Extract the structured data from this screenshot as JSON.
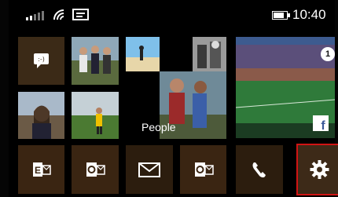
{
  "status_bar": {
    "time": "10:40",
    "icons": [
      "signal-icon",
      "wifi-icon",
      "message-icon",
      "battery-icon"
    ]
  },
  "tiles": [
    {
      "name": "messaging",
      "icon": "messaging-icon",
      "label": ""
    },
    {
      "name": "people",
      "label": "People"
    },
    {
      "name": "facebook",
      "icon": "facebook-icon",
      "badge": "1"
    },
    {
      "name": "exchange",
      "icon": "exchange-icon"
    },
    {
      "name": "outlook",
      "icon": "outlook-icon"
    },
    {
      "name": "mail",
      "icon": "mail-icon"
    },
    {
      "name": "outlook-2",
      "icon": "outlook-icon"
    },
    {
      "name": "phone",
      "icon": "phone-icon"
    },
    {
      "name": "settings",
      "icon": "gear-icon",
      "highlighted": true
    }
  ],
  "colors": {
    "highlight": "#d01414",
    "tile_brown": "#3a2512"
  }
}
